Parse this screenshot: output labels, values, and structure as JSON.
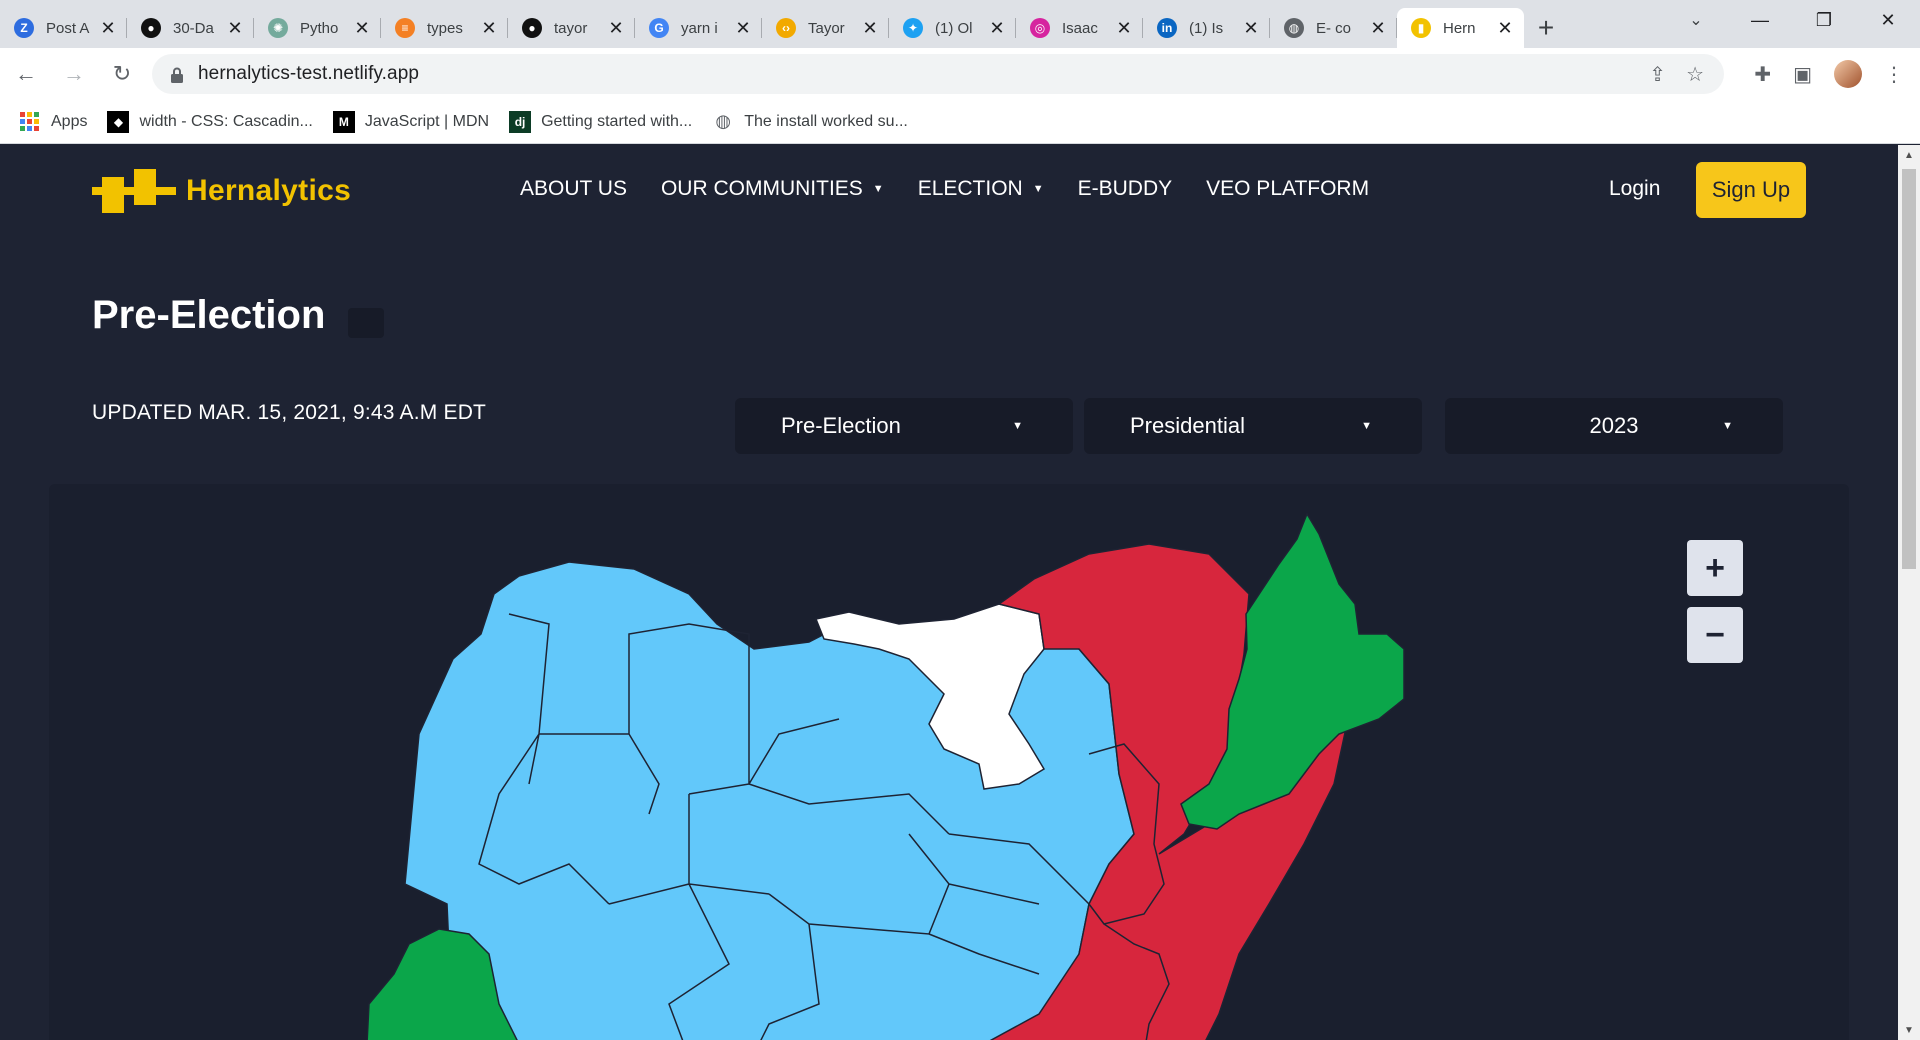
{
  "browser": {
    "tabs": [
      {
        "title": "Post A",
        "icon": "z-icon",
        "color": "#2d6cdf",
        "glyph": "Z"
      },
      {
        "title": "30-Da",
        "icon": "github-icon",
        "color": "#111111",
        "glyph": "●"
      },
      {
        "title": "Pytho",
        "icon": "openai-icon",
        "color": "#74aa9c",
        "glyph": "✺"
      },
      {
        "title": "types",
        "icon": "stackoverflow-icon",
        "color": "#f48024",
        "glyph": "≡"
      },
      {
        "title": "tayor",
        "icon": "github-icon",
        "color": "#111111",
        "glyph": "●"
      },
      {
        "title": "yarn i",
        "icon": "google-icon",
        "color": "#4285f4",
        "glyph": "G"
      },
      {
        "title": "Tayor",
        "icon": "code-icon",
        "color": "#f2a900",
        "glyph": "‹›"
      },
      {
        "title": "(1) Ol",
        "icon": "twitter-icon",
        "color": "#1da1f2",
        "glyph": "✦"
      },
      {
        "title": "Isaac",
        "icon": "instagram-icon",
        "color": "#d6249f",
        "glyph": "◎"
      },
      {
        "title": "(1) Is",
        "icon": "linkedin-icon",
        "color": "#0a66c2",
        "glyph": "in"
      },
      {
        "title": "E- co",
        "icon": "globe-icon",
        "color": "#5f6368",
        "glyph": "◍"
      },
      {
        "title": "Hern",
        "icon": "hernalytics-icon",
        "color": "#f2c200",
        "glyph": "▮",
        "active": true
      }
    ],
    "url": "hernalytics-test.netlify.app",
    "bookmarks": [
      {
        "label": "Apps",
        "icon": "apps-grid-icon"
      },
      {
        "label": "width - CSS: Cascadin...",
        "icon": "mdn-icon"
      },
      {
        "label": "JavaScript | MDN",
        "icon": "mdn-icon"
      },
      {
        "label": "Getting started with...",
        "icon": "django-icon"
      },
      {
        "label": "The install worked su...",
        "icon": "globe-icon"
      }
    ]
  },
  "site": {
    "logo_text": "Hernalytics",
    "nav": [
      {
        "label": "ABOUT US",
        "dropdown": false
      },
      {
        "label": "OUR COMMUNITIES",
        "dropdown": true
      },
      {
        "label": "ELECTION",
        "dropdown": true
      },
      {
        "label": "E-BUDDY",
        "dropdown": false
      },
      {
        "label": "VEO PLATFORM",
        "dropdown": false
      }
    ],
    "login": "Login",
    "signup": "Sign Up",
    "accent": "#f7c61a"
  },
  "main": {
    "title": "Pre-Election",
    "updated": "UPDATED MAR. 15, 2021, 9:43 A.M EDT",
    "filters": [
      {
        "value": "Pre-Election"
      },
      {
        "value": "Presidential"
      },
      {
        "value": "2023"
      }
    ],
    "zoom_in": "+",
    "zoom_out": "−",
    "map_colors": {
      "blue": "#62c8fa",
      "red": "#d7263d",
      "green": "#0ba64a",
      "white": "#ffffff"
    }
  }
}
